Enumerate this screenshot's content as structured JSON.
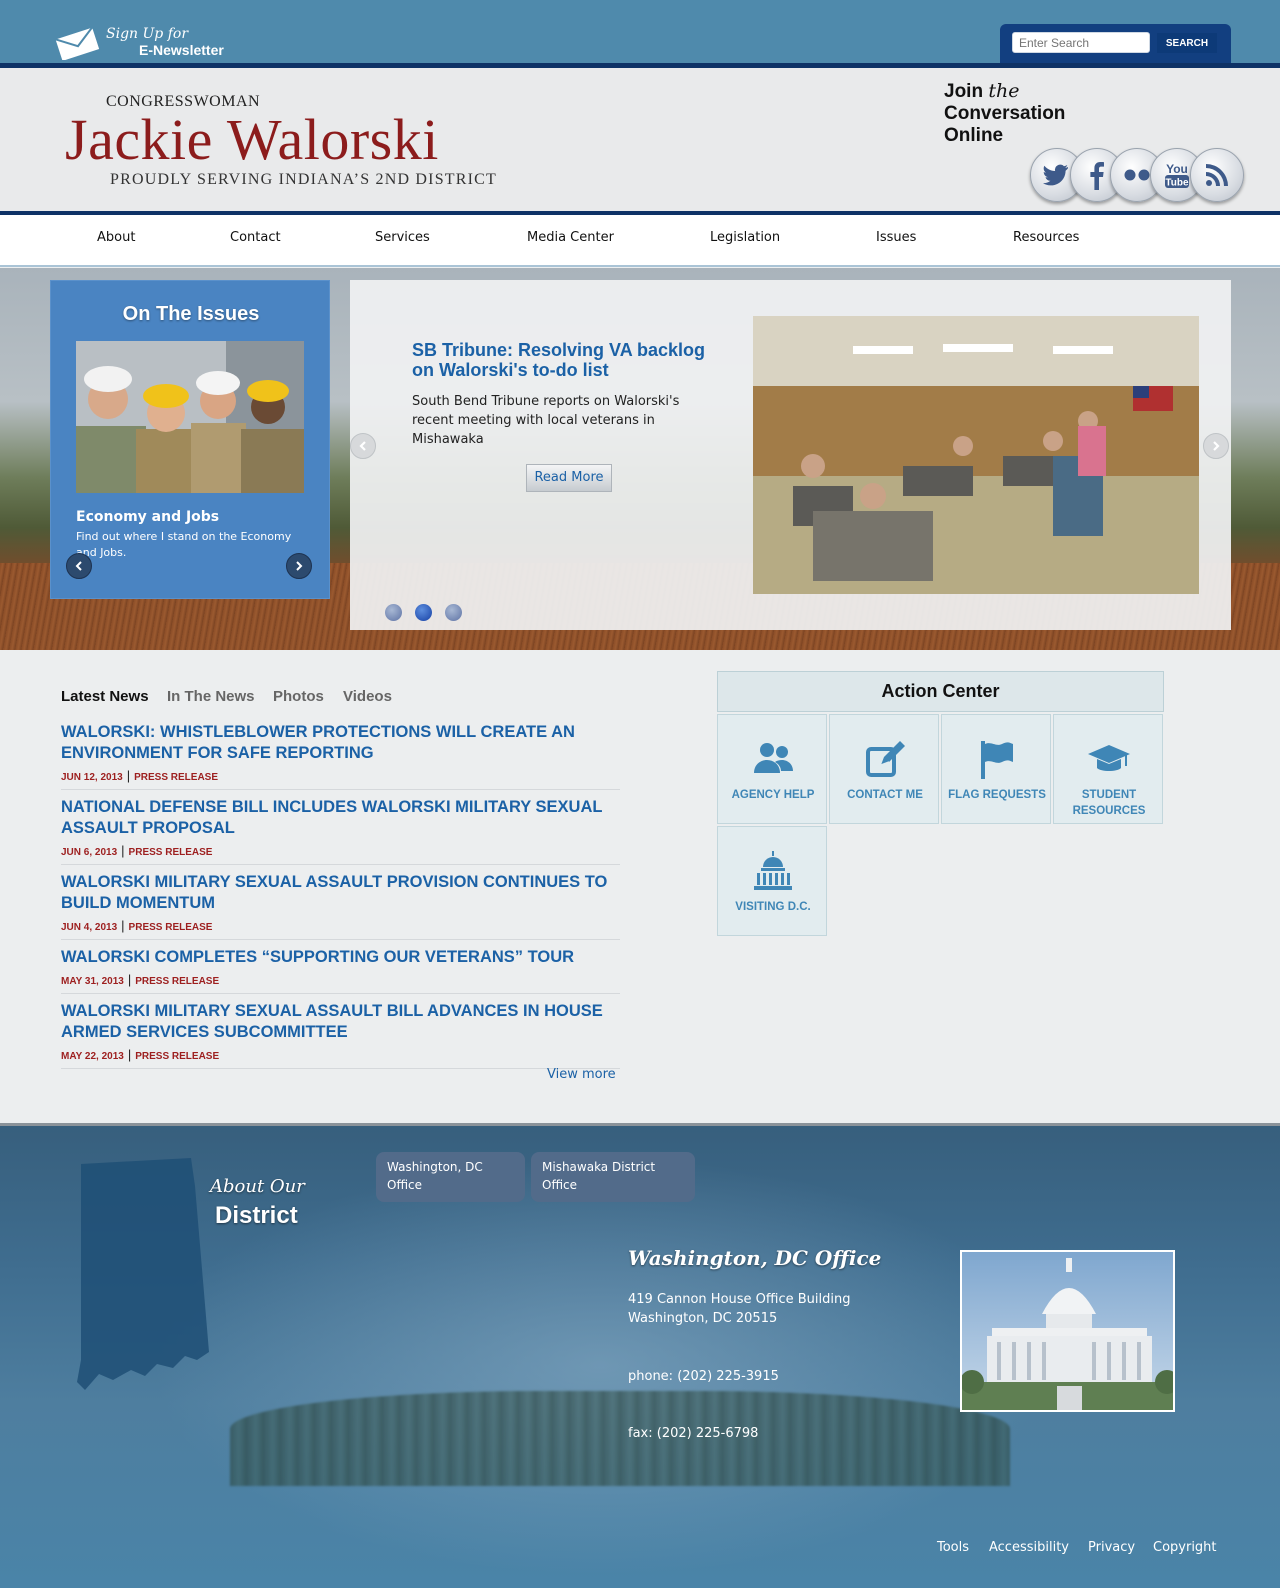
{
  "topbar": {
    "newsletter_line1": "Sign Up for",
    "newsletter_line2": "E-Newsletter",
    "search_placeholder": "Enter Search",
    "search_button": "SEARCH"
  },
  "header": {
    "prefix": "CONGRESSWOMAN",
    "name": "Jackie Walorski",
    "tagline": "PROUDLY SERVING INDIANA’S 2ND DISTRICT",
    "join_line1": "Join",
    "join_the": "the",
    "join_line2": "Conversation",
    "join_line3": "Online",
    "social": [
      "twitter-icon",
      "facebook-icon",
      "flickr-icon",
      "youtube-icon",
      "rss-icon"
    ]
  },
  "nav": [
    "About",
    "Contact",
    "Services",
    "Media Center",
    "Legislation",
    "Issues",
    "Resources"
  ],
  "issues": {
    "title": "On The Issues",
    "subtitle": "Economy and Jobs",
    "description": "Find out where I stand on the Economy and Jobs."
  },
  "slider": {
    "title": "SB Tribune: Resolving VA backlog on Walorski's to-do list",
    "description": "South Bend Tribune reports on Walorski's recent meeting with local veterans in Mishawaka",
    "read_more": "Read More",
    "active_dot": 2,
    "dot_count": 3
  },
  "news": {
    "tabs": [
      "Latest News",
      "In The News",
      "Photos",
      "Videos"
    ],
    "items": [
      {
        "title": "WALORSKI: WHISTLEBLOWER PROTECTIONS WILL CREATE AN ENVIRONMENT FOR SAFE REPORTING",
        "date": "JUN 12, 2013",
        "type": "PRESS RELEASE"
      },
      {
        "title": "NATIONAL DEFENSE BILL INCLUDES WALORSKI MILITARY SEXUAL ASSAULT PROPOSAL",
        "date": "JUN 6, 2013",
        "type": "PRESS RELEASE"
      },
      {
        "title": "WALORSKI MILITARY SEXUAL ASSAULT PROVISION CONTINUES TO BUILD MOMENTUM",
        "date": "JUN 4, 2013",
        "type": "PRESS RELEASE"
      },
      {
        "title": "WALORSKI COMPLETES “SUPPORTING OUR VETERANS” TOUR",
        "date": "MAY 31, 2013",
        "type": "PRESS RELEASE"
      },
      {
        "title": "WALORSKI MILITARY SEXUAL ASSAULT BILL ADVANCES IN HOUSE ARMED SERVICES SUBCOMMITTEE",
        "date": "MAY 22, 2013",
        "type": "PRESS RELEASE"
      }
    ],
    "view_more": "View more"
  },
  "action_center": {
    "title": "Action Center",
    "tiles": [
      {
        "label": "AGENCY HELP",
        "icon": "users-icon"
      },
      {
        "label": "CONTACT ME",
        "icon": "edit-icon"
      },
      {
        "label": "FLAG REQUESTS",
        "icon": "flag-icon"
      },
      {
        "label": "STUDENT RESOURCES",
        "icon": "graduation-cap-icon"
      },
      {
        "label": "VISITING D.C.",
        "icon": "capitol-icon"
      }
    ]
  },
  "footer": {
    "about_our": "About Our",
    "district": "District",
    "office_tabs": [
      "Washington, DC Office",
      "Mishawaka District Office"
    ],
    "office": {
      "name": "Washington, DC Office",
      "address1": "419 Cannon House Office Building",
      "address2": "Washington, DC 20515",
      "phone": "phone: (202) 225-3915",
      "fax": "fax: (202) 225-6798"
    },
    "links": [
      "Tools",
      "Accessibility",
      "Privacy",
      "Copyright"
    ]
  },
  "colors": {
    "brand_navy": "#0e3266",
    "link_blue": "#1b61a6",
    "press_red": "#9d1f1f",
    "name_red": "#8c1c1c",
    "action_blue": "#3f86b6"
  }
}
